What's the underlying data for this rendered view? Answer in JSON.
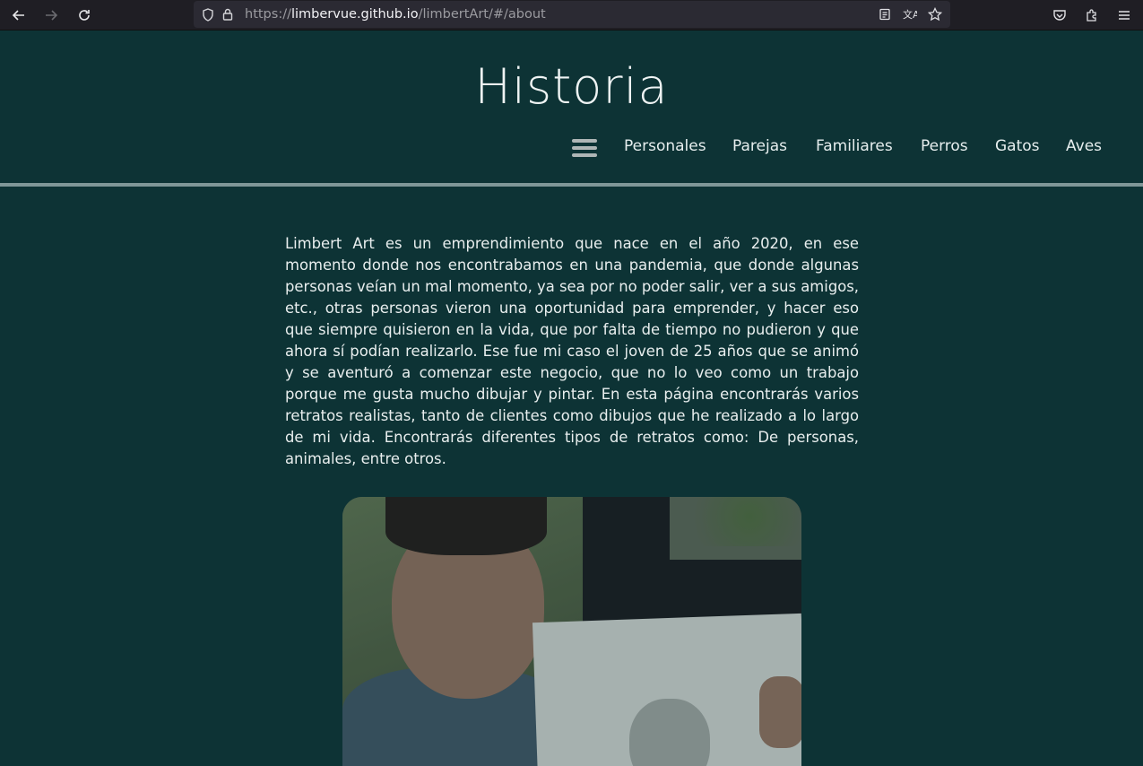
{
  "browser": {
    "url_scheme": "https://",
    "url_host": "limbervue.github.io",
    "url_path": "/limbertArt/#/about"
  },
  "header": {
    "title": "Historia",
    "nav": [
      {
        "label": "Personales"
      },
      {
        "label": "Parejas"
      },
      {
        "label": "Familiares"
      },
      {
        "label": "Perros"
      },
      {
        "label": "Gatos"
      },
      {
        "label": "Aves"
      }
    ]
  },
  "about": {
    "paragraph": "Limbert Art es un emprendimiento que nace en el año 2020, en ese momento donde nos encontrabamos en una pandemia, que donde algunas personas veían un mal momento, ya sea por no poder salir, ver a sus amigos, etc., otras personas vieron una oportunidad para emprender, y hacer eso que siempre quisieron en la vida, que por falta de tiempo no pudieron y que ahora sí podían realizarlo. Ese fue mi caso el joven de 25 años que se animó y se aventuró a comenzar este negocio, que no lo veo como un trabajo porque me gusta mucho dibujar y pintar. En esta página encontrarás varios retratos realistas, tanto de clientes como dibujos que he realizado a lo largo de mi vida. Encontrarás diferentes tipos de retratos como: De personas, animales, entre otros."
  },
  "colors": {
    "background": "#0d3335",
    "divider": "#7f9798",
    "text": "#e8eeee"
  },
  "icons": {
    "back": "arrow-left-icon",
    "forward": "arrow-right-icon",
    "reload": "reload-icon",
    "shield": "shield-icon",
    "lock": "lock-icon",
    "reader": "reader-view-icon",
    "translate": "translate-icon",
    "bookmark": "star-icon",
    "pocket": "pocket-icon",
    "extensions": "extensions-icon",
    "menu": "hamburger-menu-icon"
  }
}
